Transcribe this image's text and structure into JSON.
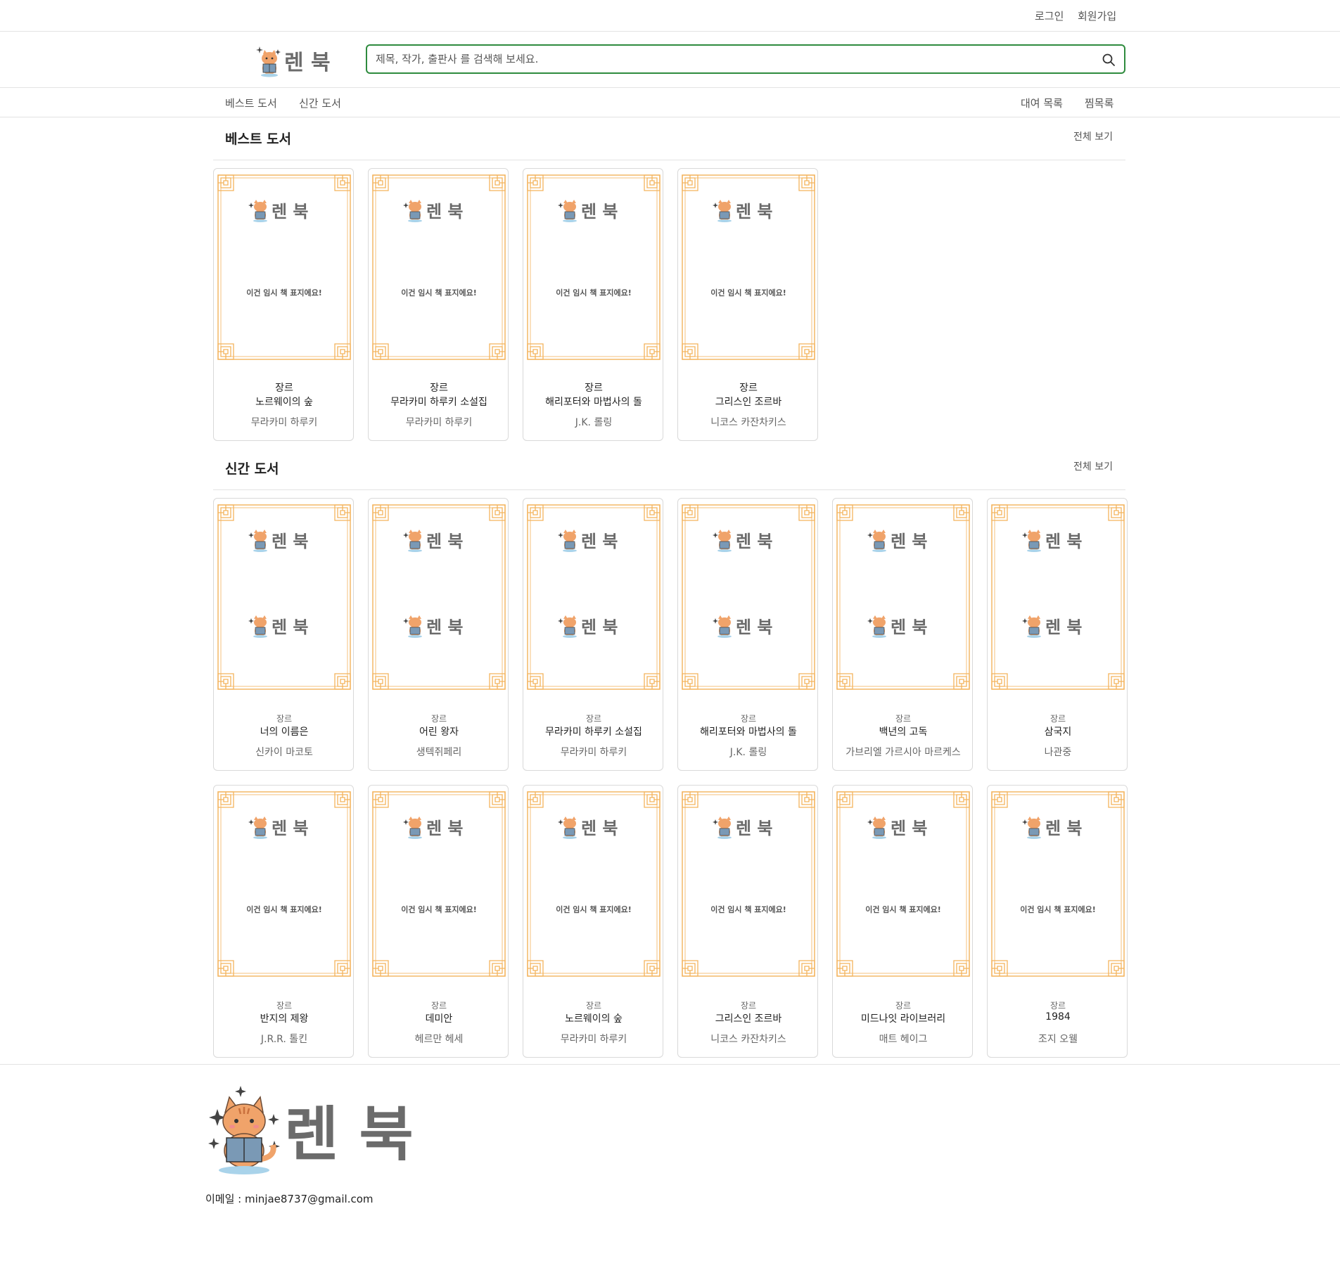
{
  "top_links": {
    "login": "로그인",
    "signup": "회원가입"
  },
  "brand": {
    "name": "렌 북"
  },
  "search": {
    "placeholder": "제목, 작가, 출판사 를 검색해 보세요.",
    "value": ""
  },
  "nav": {
    "best": "베스트 도서",
    "new": "신간 도서",
    "rentals": "대여 목록",
    "wishlist": "찜목록"
  },
  "cover_text": "이건 임시 책 표지에요!",
  "best_section": {
    "title": "베스트 도서",
    "view_all": "전체 보기",
    "books": [
      {
        "genre": "장르",
        "title": "노르웨이의 숲",
        "author": "무라카미 하루키"
      },
      {
        "genre": "장르",
        "title": "무라카미 하루키 소설집",
        "author": "무라카미 하루키"
      },
      {
        "genre": "장르",
        "title": "해리포터와 마법사의 돌",
        "author": "J.K. 롤링"
      },
      {
        "genre": "장르",
        "title": "그리스인 조르바",
        "author": "니코스 카잔차키스"
      }
    ]
  },
  "new_section": {
    "title": "신간 도서",
    "view_all": "전체 보기",
    "books": [
      {
        "genre": "장르",
        "title": "너의 이름은",
        "author": "신카이 마코토"
      },
      {
        "genre": "장르",
        "title": "어린 왕자",
        "author": "생텍쥐페리"
      },
      {
        "genre": "장르",
        "title": "무라카미 하루키 소설집",
        "author": "무라카미 하루키"
      },
      {
        "genre": "장르",
        "title": "해리포터와 마법사의 돌",
        "author": "J.K. 롤링"
      },
      {
        "genre": "장르",
        "title": "백년의 고독",
        "author": "가브리엘 가르시아 마르케스"
      },
      {
        "genre": "장르",
        "title": "삼국지",
        "author": "나관중"
      },
      {
        "genre": "장르",
        "title": "반지의 제왕",
        "author": "J.R.R. 톨킨"
      },
      {
        "genre": "장르",
        "title": "데미안",
        "author": "헤르만 헤세"
      },
      {
        "genre": "장르",
        "title": "노르웨이의 숲",
        "author": "무라카미 하루키"
      },
      {
        "genre": "장르",
        "title": "그리스인 조르바",
        "author": "니코스 카잔차키스"
      },
      {
        "genre": "장르",
        "title": "미드나잇 라이브러리",
        "author": "매트 헤이그"
      },
      {
        "genre": "장르",
        "title": "1984",
        "author": "조지 오웰"
      }
    ]
  },
  "footer": {
    "email": "이메일 : minjae8737@gmail.com"
  },
  "colors": {
    "accent_green": "#2e8b3e",
    "cover_frame": "#f3b35c",
    "cat_orange": "#f0a36a",
    "brand_gray": "#6b6b6b"
  }
}
